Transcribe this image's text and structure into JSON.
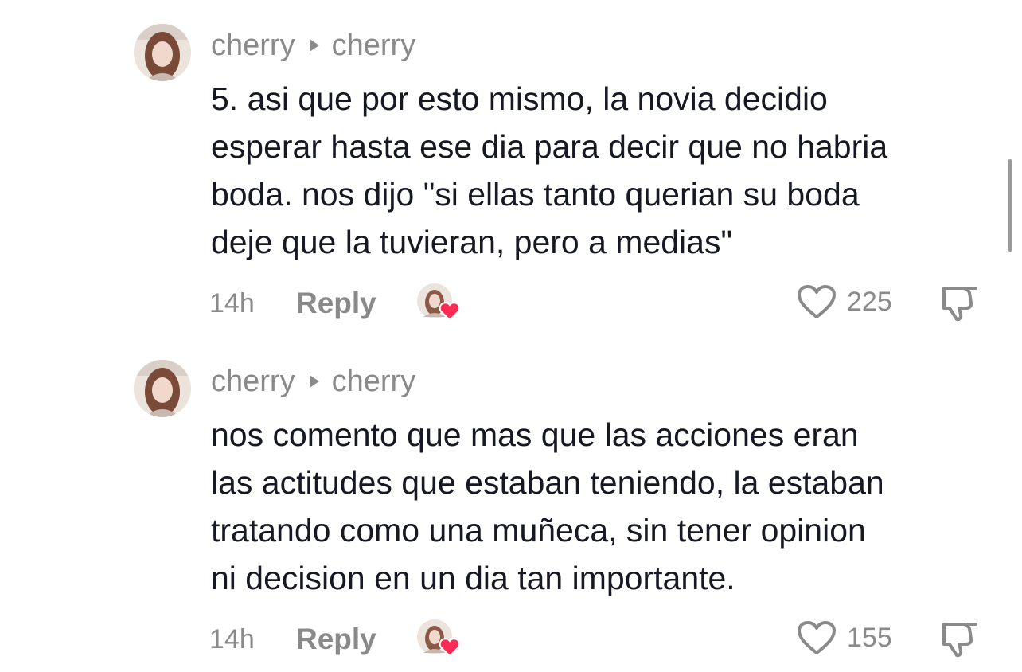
{
  "comments": [
    {
      "author": "cherry",
      "reply_to": "cherry",
      "text": "5. asi que por esto mismo, la novia decidio\nesperar hasta ese dia para decir que no habria\nboda. nos dijo \"si ellas tanto querian su boda\ndeje que la tuvieran, pero a medias\"",
      "time": "14h",
      "reply_label": "Reply",
      "likes": "225"
    },
    {
      "author": "cherry",
      "reply_to": "cherry",
      "text": "nos comento que mas que las acciones eran\nlas actitudes que estaban teniendo, la estaban\ntratando como una muñeca, sin tener opinion\nni decision en un dia tan importante.",
      "time": "14h",
      "reply_label": "Reply",
      "likes": "155"
    }
  ],
  "icons": {
    "reply_arrow": "caret-right-icon",
    "like": "heart-outline-icon",
    "dislike": "thumbs-down-icon",
    "creator_liked": "creator-heart-badge-icon"
  },
  "colors": {
    "text": "#161823",
    "muted": "#8a8a8a",
    "heart_badge": "#fe2c55"
  }
}
